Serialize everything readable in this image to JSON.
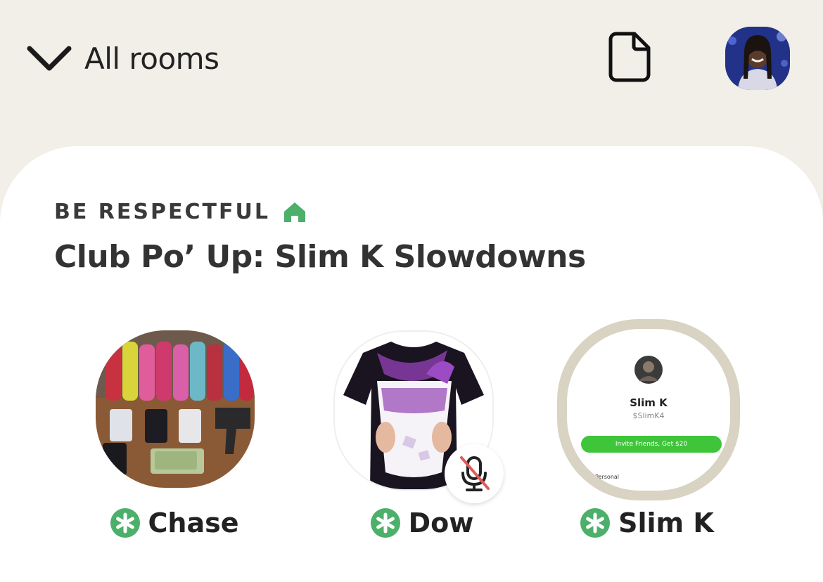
{
  "header": {
    "rooms_label": "All rooms",
    "icons": [
      "chevron-down-icon",
      "document-icon"
    ]
  },
  "room": {
    "club_name": "BE RESPECTFUL",
    "title": "Club Po’ Up: Slim K Slowdowns"
  },
  "speakers": [
    {
      "name": "Chase",
      "moderator": true,
      "muted": false,
      "speaking": false
    },
    {
      "name": "Dow",
      "moderator": true,
      "muted": true,
      "speaking": false
    },
    {
      "name": "Slim K",
      "moderator": true,
      "muted": false,
      "speaking": true
    }
  ],
  "profile_card": {
    "name": "Slim K",
    "cashtag": "$SlimK4",
    "button": "Invite Friends, Get $20",
    "section": "Personal"
  },
  "colors": {
    "background": "#f1efe7",
    "card": "#ffffff",
    "moderator_green": "#4caf6a",
    "speaking_ring": "#d8d3c2",
    "cash_green": "#3fc53a"
  }
}
